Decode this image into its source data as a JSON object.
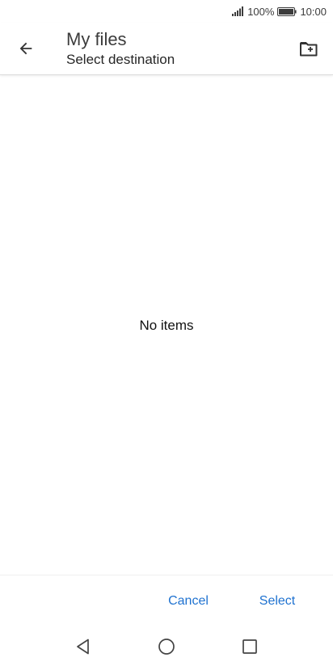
{
  "status_bar": {
    "battery_percent": "100%",
    "time": "10:00",
    "icons": [
      "signal-icon",
      "battery-icon"
    ]
  },
  "app_bar": {
    "title": "My files",
    "subtitle": "Select destination",
    "back_icon": "arrow-left-icon",
    "new_folder_icon": "new-folder-icon"
  },
  "content": {
    "empty_message": "No items"
  },
  "actions": {
    "cancel_label": "Cancel",
    "select_label": "Select"
  },
  "nav_bar": {
    "icons": [
      "triangle-back-icon",
      "circle-home-icon",
      "square-recents-icon"
    ]
  },
  "colors": {
    "accent": "#1f72d0",
    "background": "#ffffff"
  }
}
